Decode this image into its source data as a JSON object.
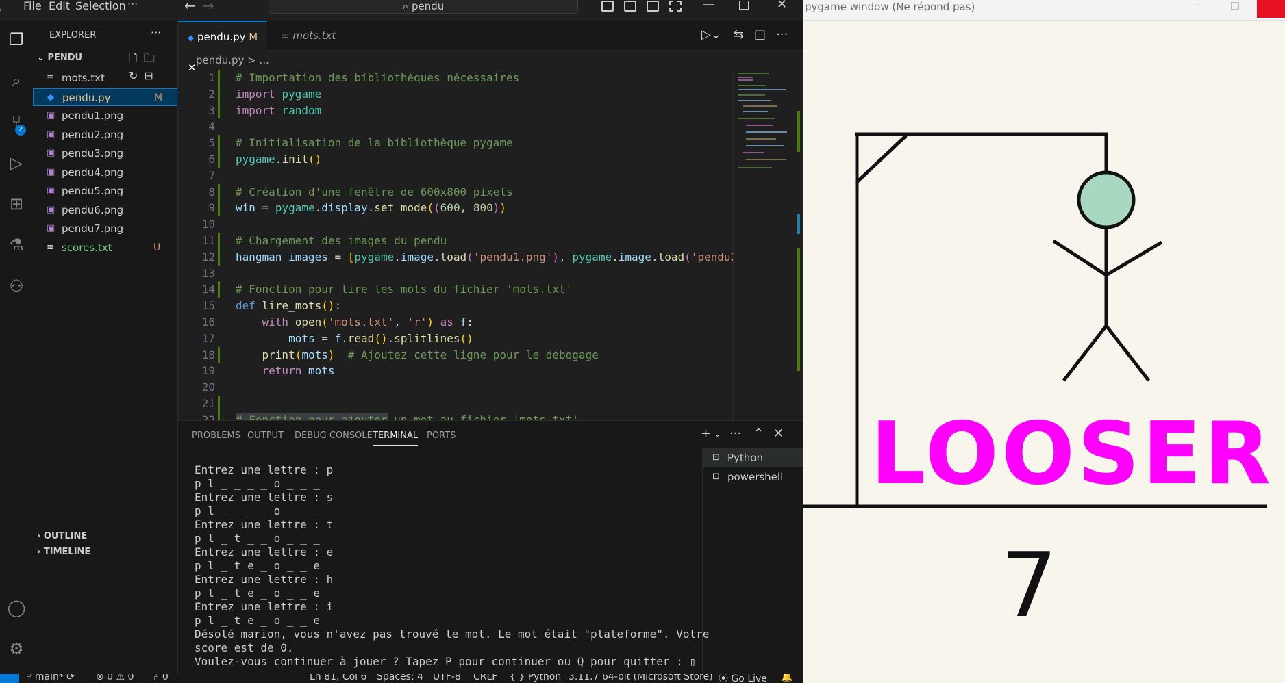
{
  "titlebar": {
    "menu": [
      "File",
      "Edit",
      "Selection"
    ],
    "more": "···",
    "search": "pendu",
    "back": "←",
    "forward": "→",
    "minimize": "—",
    "close": "✕"
  },
  "activity": {
    "scm_badge": "2"
  },
  "explorer": {
    "header": "EXPLORER",
    "header_more": "···",
    "folder": "PENDU",
    "files": [
      {
        "name": "mots.txt",
        "status": ""
      },
      {
        "name": "pendu.py",
        "status": "M"
      },
      {
        "name": "pendu1.png",
        "status": ""
      },
      {
        "name": "pendu2.png",
        "status": ""
      },
      {
        "name": "pendu3.png",
        "status": ""
      },
      {
        "name": "pendu4.png",
        "status": ""
      },
      {
        "name": "pendu5.png",
        "status": ""
      },
      {
        "name": "pendu6.png",
        "status": ""
      },
      {
        "name": "pendu7.png",
        "status": ""
      },
      {
        "name": "scores.txt",
        "status": "U"
      }
    ],
    "outline": "OUTLINE",
    "timeline": "TIMELINE"
  },
  "tabs": {
    "active_name": "pendu.py",
    "active_status": "M",
    "inactive_name": "mots.txt",
    "close": "✕",
    "more": "···"
  },
  "breadcrumb": "pendu.py > ...",
  "code_lines": [
    "1",
    "2",
    "3",
    "4",
    "5",
    "6",
    "7",
    "8",
    "9",
    "10",
    "11",
    "12",
    "13",
    "14",
    "15",
    "16",
    "17",
    "18",
    "19",
    "20",
    "21",
    "22"
  ],
  "panel": {
    "tabs": [
      "PROBLEMS",
      "OUTPUT",
      "DEBUG CONSOLE",
      "TERMINAL",
      "PORTS"
    ],
    "active_tab": "TERMINAL",
    "plus": "+",
    "more": "···",
    "close": "✕",
    "terminal_lines": [
      "Entrez une lettre : p",
      "p l _ _ _ _ o _ _ _",
      "Entrez une lettre : s",
      "p l _ _ _ _ o _ _ _",
      "Entrez une lettre : t",
      "p l _ t _ _ o _ _ _",
      "Entrez une lettre : e",
      "p l _ t e _ o _ _ e",
      "Entrez une lettre : h",
      "p l _ t e _ o _ _ e",
      "Entrez une lettre : i",
      "p l _ t e _ o _ _ e",
      "Désolé marion, vous n'avez pas trouvé le mot. Le mot était \"plateforme\". Votre",
      "score est de 0.",
      "Voulez-vous continuer à jouer ? Tapez P pour continuer ou Q pour quitter : ▯"
    ],
    "terminals": [
      "Python",
      "powershell"
    ]
  },
  "statusbar": {
    "branch": "main*",
    "errors": "⊗ 0 ⚠ 0",
    "ports": "⑃ 0",
    "position": "Ln 81, Col 6",
    "spaces": "Spaces: 4",
    "encoding": "UTF-8",
    "eol": "CRLF",
    "language": "{ } Python",
    "interpreter": "3.11.7 64-bit (Microsoft Store)",
    "golive": "Go Live"
  },
  "pygame": {
    "title": "pygame window (Ne répond pas)",
    "message": "LOOSER",
    "score": "7"
  }
}
